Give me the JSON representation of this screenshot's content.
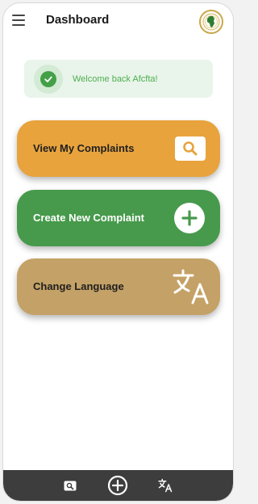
{
  "header": {
    "title": "Dashboard",
    "menu_icon": "hamburger-menu-icon",
    "logo_icon": "afcfta-logo"
  },
  "banner": {
    "message": "Welcome back Afcfta!",
    "icon": "check-circle-icon"
  },
  "actions": [
    {
      "label": "View My Complaints",
      "icon": "search-icon",
      "color": "#e8a33d"
    },
    {
      "label": "Create New Complaint",
      "icon": "add-circle-icon",
      "color": "#479a4c"
    },
    {
      "label": "Change Language",
      "icon": "translate-icon",
      "color": "#c4a166"
    }
  ],
  "bottom_nav": {
    "items": [
      {
        "icon": "search-icon"
      },
      {
        "icon": "add-circle-icon"
      },
      {
        "icon": "translate-icon"
      }
    ],
    "background": "#3d3d3d"
  }
}
